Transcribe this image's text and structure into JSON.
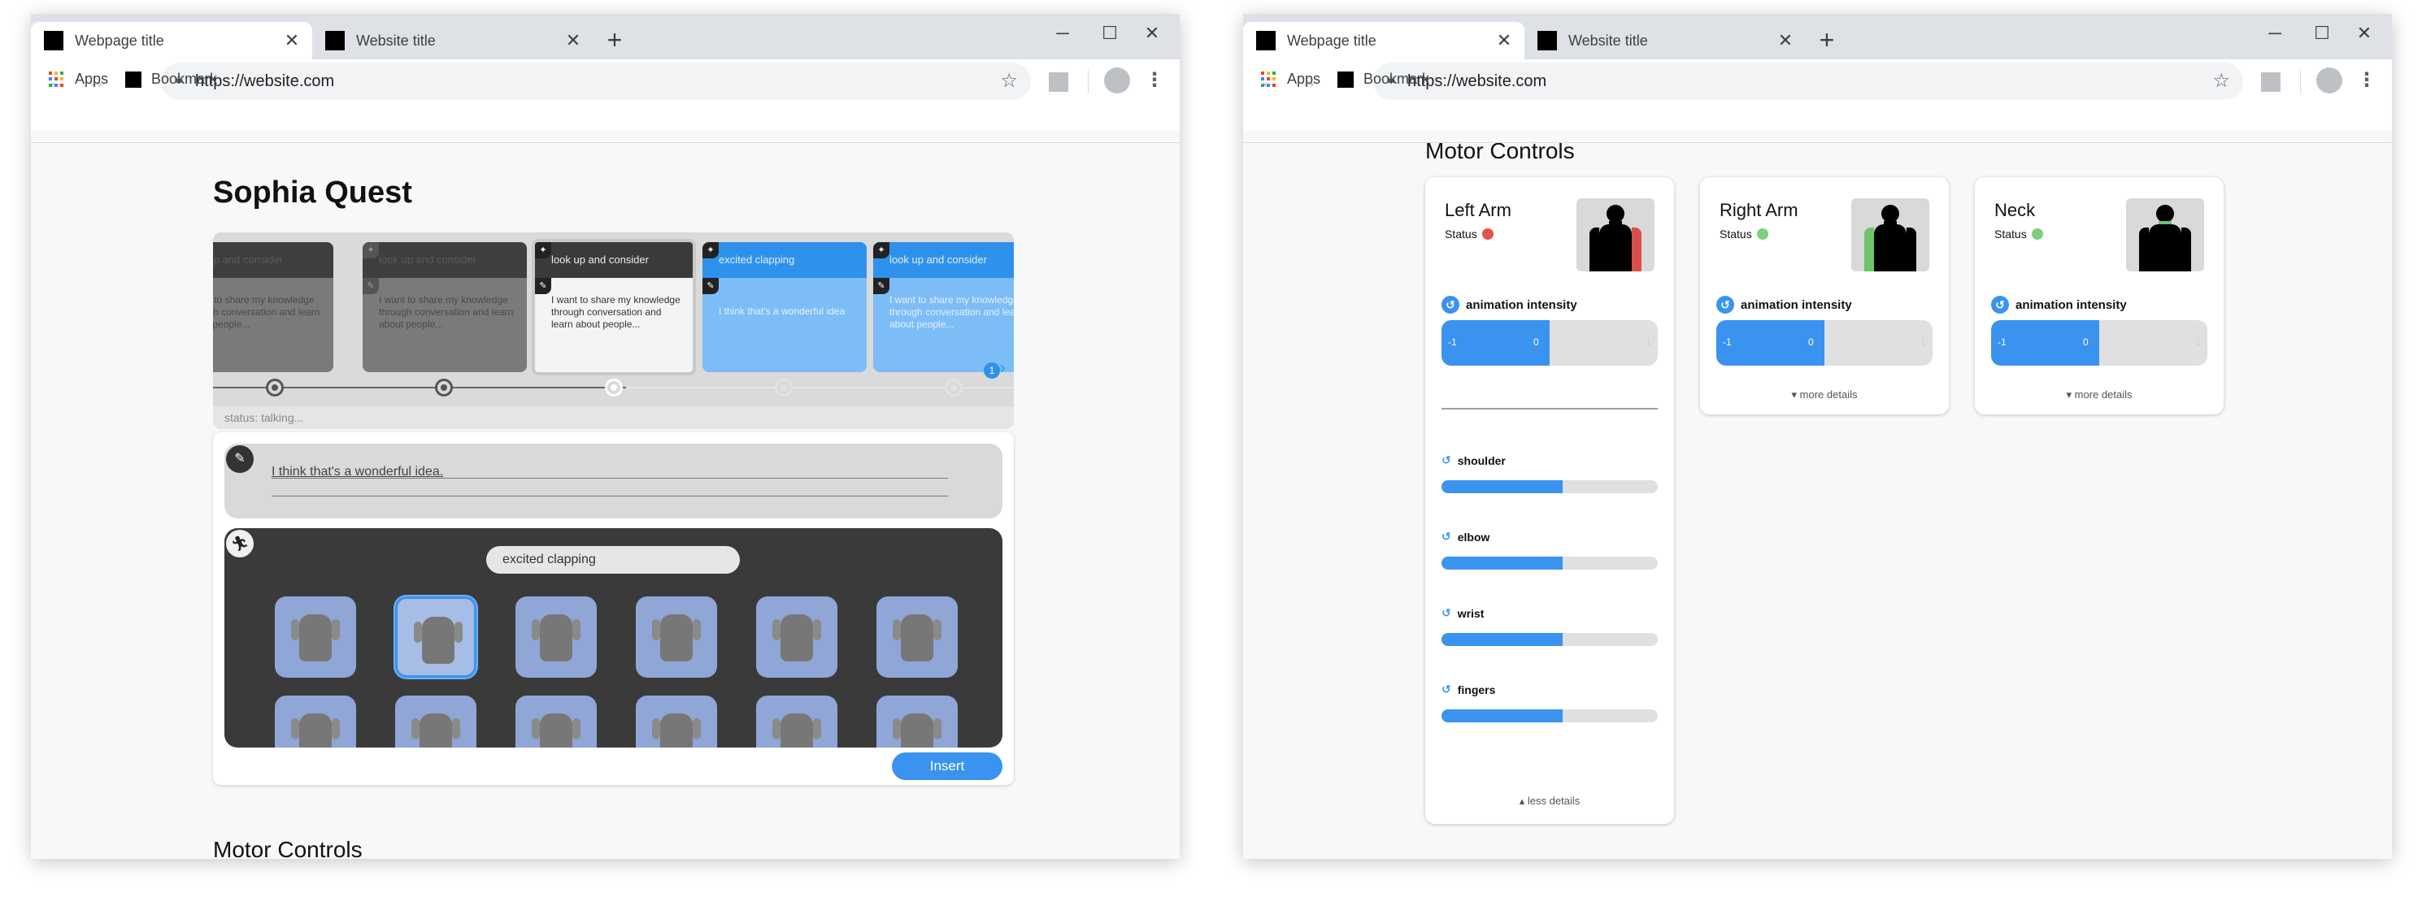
{
  "left_window": {
    "tabs": [
      {
        "title": "Webpage title",
        "close": "✕"
      },
      {
        "title": "Website title",
        "close": "✕"
      }
    ],
    "new_tab": "+",
    "window_controls": {
      "minimize": "─",
      "maximize": "☐",
      "close": "✕"
    },
    "url": "https://website.com",
    "bookmarks": {
      "apps": "Apps",
      "bookmark": "Bookmark"
    }
  },
  "right_window": {
    "tabs": [
      {
        "title": "Webpage title",
        "close": "✕"
      },
      {
        "title": "Website title",
        "close": "✕"
      }
    ],
    "new_tab": "+",
    "window_controls": {
      "minimize": "─",
      "maximize": "☐",
      "close": "✕"
    },
    "url": "https://website.com",
    "bookmarks": {
      "apps": "Apps",
      "bookmark": "Bookmark"
    }
  },
  "app": {
    "title": "Sophia Quest",
    "timeline": {
      "cards": [
        {
          "head": "look up and consider",
          "body": "I want to share my knowledge through conversation and learn about people...",
          "state": "past"
        },
        {
          "head": "look up and consider",
          "body": "I want to share my knowledge through conversation and learn about people...",
          "state": "past"
        },
        {
          "head": "look up and consider",
          "body": "I want to share my knowledge through conversation and learn about people...",
          "state": "current"
        },
        {
          "head": "excited clapping",
          "body": "I think that's a wonderful idea",
          "state": "future"
        },
        {
          "head": "look up and consider",
          "body": "I want to share my knowledge through conversation and learn about people...",
          "state": "future"
        }
      ],
      "badge": "1",
      "status": "status: talking..."
    },
    "editor": {
      "speech_text": "I think that's a wonderful idea.",
      "gesture_search": "excited clapping",
      "selected_tile": 1,
      "insert_label": "Insert"
    },
    "motor_title": "Motor Controls"
  },
  "motor": {
    "title": "Motor Controls",
    "status_label": "Status",
    "intensity_label": "animation intensity",
    "intensity_min": "-1",
    "intensity_value": "0",
    "intensity_max": "1",
    "more_details": "more details",
    "less_details": "less details",
    "cards": [
      {
        "name": "Left Arm",
        "status_color": "#e8504b",
        "highlight": "right",
        "highlight_color": "#d9504b",
        "intensity": 0.5,
        "expanded": true
      },
      {
        "name": "Right Arm",
        "status_color": "#7fd07d",
        "highlight": "left",
        "highlight_color": "#6fc46c",
        "intensity": 0.5,
        "expanded": false
      },
      {
        "name": "Neck",
        "status_color": "#7fd07d",
        "highlight": "neck",
        "highlight_color": "#6fc46c",
        "intensity": 0.5,
        "expanded": false
      }
    ],
    "joints": [
      {
        "name": "shoulder",
        "level": 0.56
      },
      {
        "name": "elbow",
        "level": 0.56
      },
      {
        "name": "wrist",
        "level": 0.56
      },
      {
        "name": "fingers",
        "level": 0.56
      }
    ]
  },
  "icons": {
    "back": "arrow-left-icon",
    "forward": "arrow-right-icon",
    "reload": "reload-icon",
    "lock": "lock-icon",
    "star": "star-icon",
    "menu": "vertical-dots-icon",
    "speech": "pencil-icon",
    "gesture": "running-figure-icon",
    "reset": "reset-icon"
  },
  "colors": {
    "accent": "#3a93ee",
    "status_red": "#e8504b",
    "status_green": "#7fd07d"
  }
}
